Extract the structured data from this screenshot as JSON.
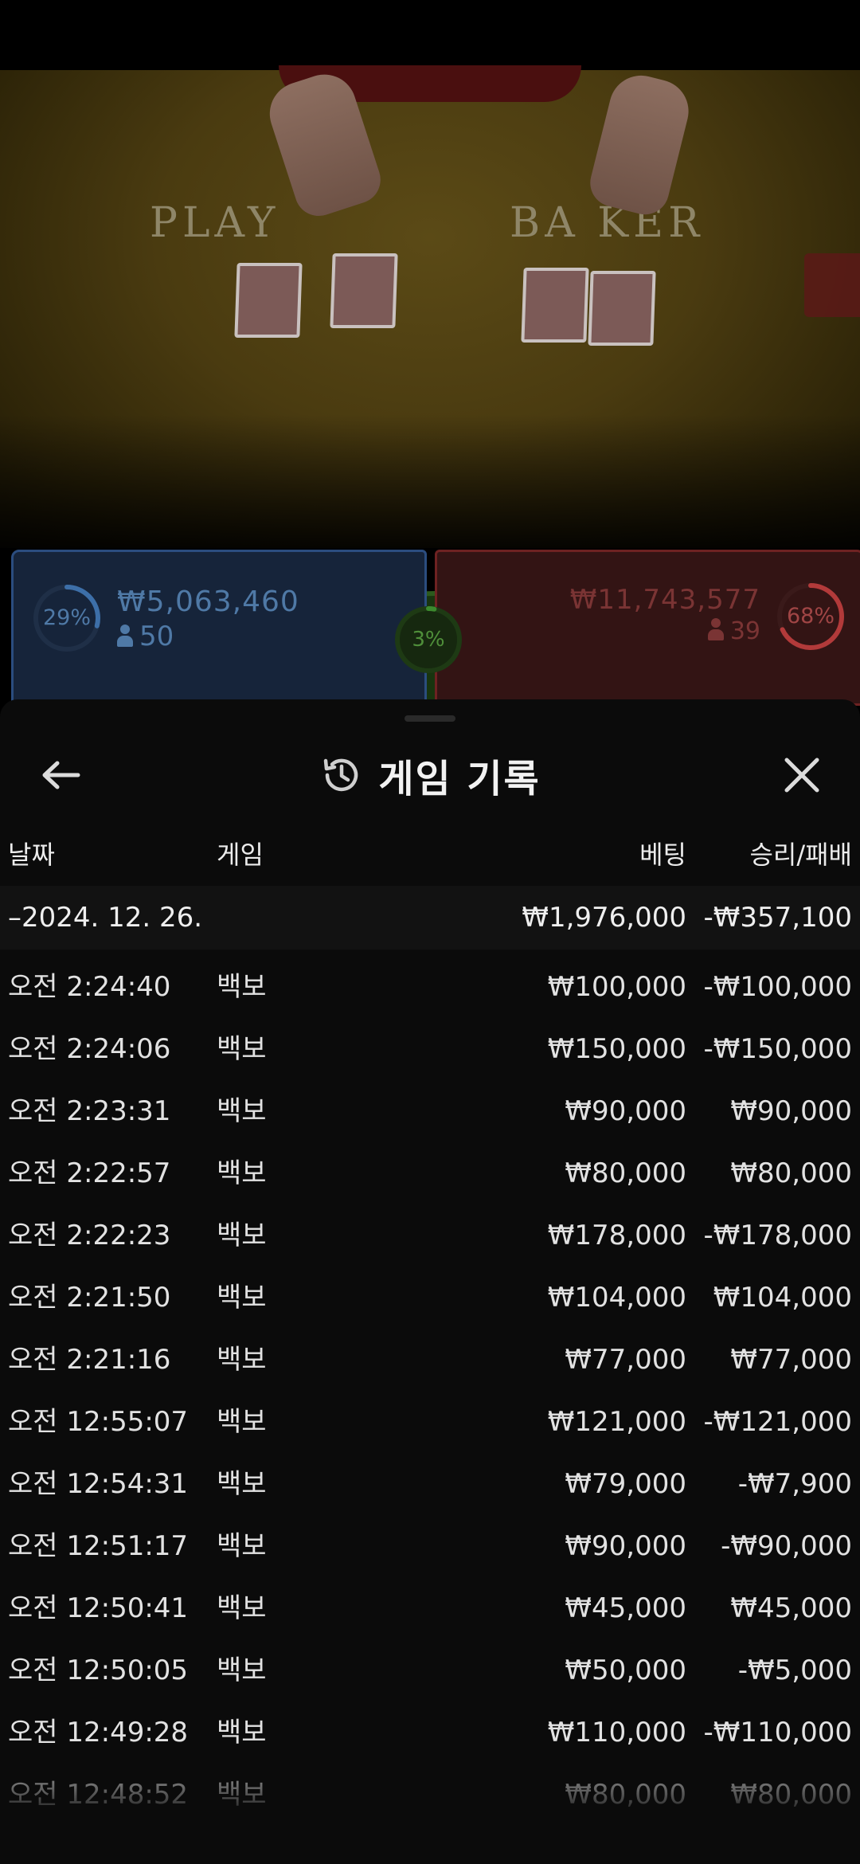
{
  "video": {
    "player_label": "PLAY",
    "banker_label": "BA    KER"
  },
  "bets": {
    "player": {
      "percent": "29%",
      "percent_value": 29,
      "amount": "₩5,063,460",
      "count": "50",
      "color": "#3d6fa8"
    },
    "tie": {
      "percent": "3%",
      "percent_value": 3,
      "color": "#3c8a2e"
    },
    "banker": {
      "percent": "68%",
      "percent_value": 68,
      "amount": "₩11,743,577",
      "count": "39",
      "color": "#b23a3a"
    }
  },
  "sheet": {
    "title": "게임 기록",
    "icons": {
      "back": "arrow-left-icon",
      "history": "history-icon",
      "close": "close-icon"
    }
  },
  "table": {
    "headers": {
      "date": "날짜",
      "game": "게임",
      "bet": "베팅",
      "result": "승리/패배"
    },
    "summary": {
      "date": "–2024. 12. 26.",
      "bet": "₩1,976,000",
      "result": "-₩357,100"
    },
    "rows": [
      {
        "time": "오전 2:24:40",
        "game": "백보",
        "bet": "₩100,000",
        "result": "-₩100,000"
      },
      {
        "time": "오전 2:24:06",
        "game": "백보",
        "bet": "₩150,000",
        "result": "-₩150,000"
      },
      {
        "time": "오전 2:23:31",
        "game": "백보",
        "bet": "₩90,000",
        "result": "₩90,000"
      },
      {
        "time": "오전 2:22:57",
        "game": "백보",
        "bet": "₩80,000",
        "result": "₩80,000"
      },
      {
        "time": "오전 2:22:23",
        "game": "백보",
        "bet": "₩178,000",
        "result": "-₩178,000"
      },
      {
        "time": "오전 2:21:50",
        "game": "백보",
        "bet": "₩104,000",
        "result": "₩104,000"
      },
      {
        "time": "오전 2:21:16",
        "game": "백보",
        "bet": "₩77,000",
        "result": "₩77,000"
      },
      {
        "time": "오전 12:55:07",
        "game": "백보",
        "bet": "₩121,000",
        "result": "-₩121,000"
      },
      {
        "time": "오전 12:54:31",
        "game": "백보",
        "bet": "₩79,000",
        "result": "-₩7,900"
      },
      {
        "time": "오전 12:51:17",
        "game": "백보",
        "bet": "₩90,000",
        "result": "-₩90,000"
      },
      {
        "time": "오전 12:50:41",
        "game": "백보",
        "bet": "₩45,000",
        "result": "₩45,000"
      },
      {
        "time": "오전 12:50:05",
        "game": "백보",
        "bet": "₩50,000",
        "result": "-₩5,000"
      },
      {
        "time": "오전 12:49:28",
        "game": "백보",
        "bet": "₩110,000",
        "result": "-₩110,000"
      },
      {
        "time": "오전 12:48:52",
        "game": "백보",
        "bet": "₩80,000",
        "result": "₩80,000"
      }
    ]
  }
}
